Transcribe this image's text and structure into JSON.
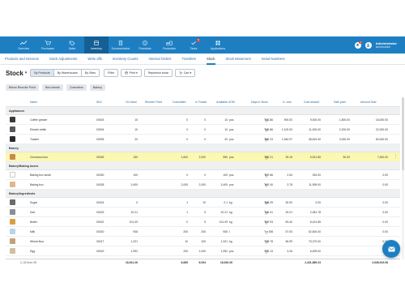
{
  "nav": {
    "items": [
      {
        "label": "Overview",
        "icon": "chart-line-icon"
      },
      {
        "label": "Purchases",
        "icon": "cart-icon"
      },
      {
        "label": "Sales",
        "icon": "tag-icon"
      },
      {
        "label": "Inventory",
        "icon": "box-icon",
        "active": true
      },
      {
        "label": "Documentation",
        "icon": "document-icon"
      },
      {
        "label": "Financials",
        "icon": "dollar-icon"
      },
      {
        "label": "Production",
        "icon": "factory-icon"
      },
      {
        "label": "Tasks",
        "icon": "checklist-icon",
        "badge": "5"
      },
      {
        "label": "Applications",
        "icon": "grid-icon"
      }
    ],
    "notifications_badge": "1",
    "user": {
      "name": "Administrator",
      "role": "administrator"
    }
  },
  "subtabs": [
    {
      "label": "Products and Services"
    },
    {
      "label": "Stock Adjustments"
    },
    {
      "label": "Write offs"
    },
    {
      "label": "Inventory Counts"
    },
    {
      "label": "Internal Orders"
    },
    {
      "label": "Transfers"
    },
    {
      "label": "Stock",
      "active": true
    },
    {
      "label": "Stock Movement"
    },
    {
      "label": "Serial Numbers"
    }
  ],
  "toolbar": {
    "title": "Stock",
    "view_options": [
      "By Products",
      "By Warehouses",
      "By Sites"
    ],
    "filter_label": "Filter",
    "print_label": "Print",
    "replenish_label": "Replenish stock",
    "cart_label": "Cart"
  },
  "chips": [
    "Below Reorder Point",
    "Bed sheets",
    "Cosmetics",
    "Bakery"
  ],
  "columns": {
    "name": "Name",
    "sku": "SKU",
    "on_hand": "On Hand",
    "reorder_point": "Reorder Point",
    "committed": "Committed",
    "in_transit": "In Transit",
    "available": "Available UOM",
    "days_in_stock": "Days in Stock",
    "unit_cost": "U. cost",
    "cost_amount": "Cost amount",
    "sale_price": "Sale price",
    "amount_sold": "Amount Sold"
  },
  "groups": [
    {
      "label": "Appliances",
      "rows": [
        {
          "name": "Coffee grinder",
          "thumb": "#3a3a3a",
          "sku": "00003",
          "on_hand": "10",
          "reorder": "",
          "committed": "0",
          "in_transit": "0",
          "available": "10",
          "uom": "pcs.",
          "days": "112.86",
          "ucost": "900.00",
          "cost": "9,000.00",
          "sale": "1,800.00",
          "sold": "18,000.00"
        },
        {
          "name": "Electric kettle",
          "thumb": "#555a60",
          "sku": "00004",
          "on_hand": "10",
          "reorder": "",
          "committed": "0",
          "in_transit": "0",
          "available": "10",
          "uom": "pcs.",
          "days": "112.86",
          "ucost": "1,100.00",
          "cost": "11,000.00",
          "sale": "2,200.00",
          "sold": "22,000.00"
        },
        {
          "name": "Toaster",
          "thumb": "#2b2b2b",
          "sku": "00005",
          "on_hand": "20",
          "reorder": "",
          "committed": "0",
          "in_transit": "0",
          "available": "20",
          "uom": "pcs.",
          "days": "262.23",
          "ucost": "1,940.97",
          "cost": "38,819.40",
          "sale": "3,000.00",
          "sold": "60,000.00"
        }
      ]
    },
    {
      "label": "Bakery",
      "rows": [
        {
          "name": "Cinnamon bun",
          "thumb": "#c98a4b",
          "sku": "00026",
          "on_hand": "150",
          "reorder": "",
          "committed": "1,600",
          "in_transit": "2,000",
          "available": "550",
          "uom": "pcs.",
          "days": "192.21",
          "ucost": "39.15",
          "cost": "5,921.85",
          "sale": "50.00",
          "sold": "7,500.00",
          "highlight": true
        }
      ]
    },
    {
      "label": "Bakery/Baking boxes",
      "rows": [
        {
          "name": "Baking box small",
          "thumb": "#ffffff",
          "sku": "00030",
          "on_hand": "100",
          "reorder": "",
          "committed": "0",
          "in_transit": "0",
          "available": "100",
          "uom": "pcs.",
          "days": "107.86",
          "ucost": "2.54",
          "cost": "254.00",
          "sale": "",
          "sold": "0.00"
        },
        {
          "name": "Baking box",
          "thumb": "#e0b98a",
          "sku": "00028",
          "on_hand": "3,400",
          "reorder": "",
          "committed": "2,000",
          "in_transit": "2,000",
          "available": "3,400",
          "uom": "pcs.",
          "days": "107.40",
          "ucost": "3.78",
          "cost": "11,995.00",
          "sale": "",
          "sold": "0.00"
        }
      ]
    },
    {
      "label": "Bakery/Ingredients",
      "rows": [
        {
          "name": "Sugar",
          "thumb": "#6b6b6b",
          "sku": "00024",
          "on_hand": "0",
          "reorder": "",
          "committed": "1",
          "in_transit": "10",
          "available": "2.1",
          "uom": "kg",
          "days": "268.29",
          "ucost": "30.00",
          "cost": "0.00",
          "sale": "",
          "sold": "0.00"
        },
        {
          "name": "Salt",
          "thumb": "#8a8f96",
          "sku": "00023",
          "on_hand": "20.21",
          "reorder": "",
          "committed": "1",
          "in_transit": "5",
          "available": "20.21",
          "uom": "kg",
          "days": "112.31",
          "ucost": "25.21",
          "cost": "2,081.78",
          "sale": "",
          "sold": "0.00"
        },
        {
          "name": "Butter",
          "thumb": "#d8a042",
          "sku": "00022",
          "on_hand": "101.09",
          "reorder": "",
          "committed": "0",
          "in_transit": "5",
          "available": "101.09",
          "uom": "kg",
          "days": "107.93",
          "ucost": "83.40",
          "cost": "8,431.85",
          "sale": "",
          "sold": "0.00"
        },
        {
          "name": "Milk",
          "thumb": "#b9d4ea",
          "sku": "00020",
          "on_hand": "908",
          "reorder": "",
          "committed": "200",
          "in_transit": "200",
          "available": "908",
          "uom": "l",
          "days": "198",
          "ucost": "57.93",
          "cost": "52,600.00",
          "sale": "",
          "sold": "0.00"
        },
        {
          "name": "Wheat flour",
          "thumb": "#c0a37a",
          "sku": "00017",
          "on_hand": "1,321",
          "reorder": "",
          "committed": "10",
          "in_transit": "100",
          "available": "1,321",
          "uom": "kg",
          "days": "178.78",
          "ucost": "56.99",
          "cost": "75,270.00",
          "sale": "",
          "sold": "0.00"
        },
        {
          "name": "Egg",
          "thumb": "#cfc0a0",
          "sku": "00019",
          "on_hand": "1,992",
          "reorder": "",
          "committed": "200",
          "in_transit": "1,000",
          "available": "1,992",
          "uom": "pcs.",
          "days": "270.13",
          "ucost": "3.26",
          "cost": "6,499.00",
          "sale": "",
          "sold": "0.00"
        }
      ]
    }
  ],
  "footer": {
    "count": "1–32 from 49",
    "on_hand": "18,541.26",
    "committed": "6,685",
    "in_transit": "6,094",
    "available": "18,949.26",
    "cost": "2,431,889.23",
    "sold": "2,638,919.08"
  },
  "colors": {
    "accent": "#1d7fc2",
    "highlight": "#fbf8b2"
  }
}
